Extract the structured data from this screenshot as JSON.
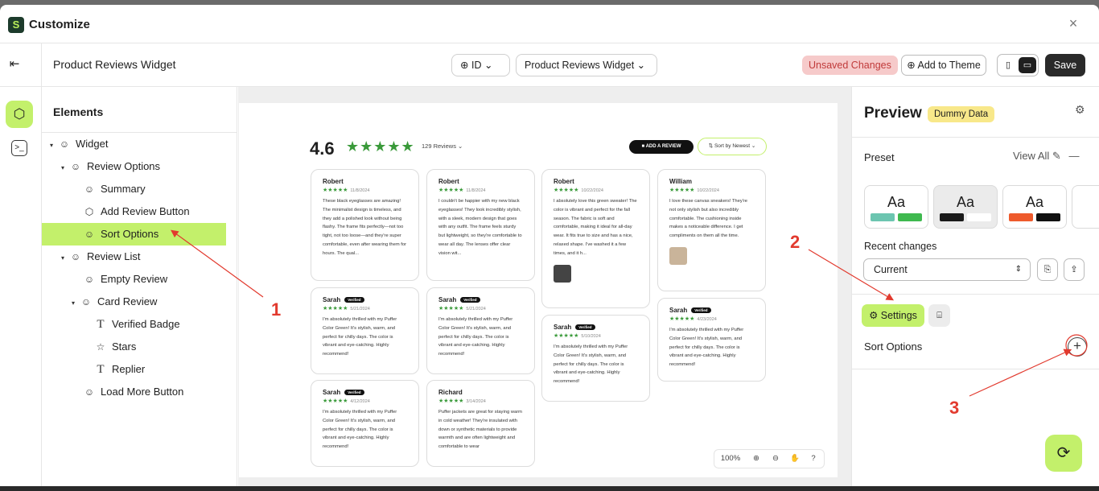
{
  "window": {
    "title": "Customize",
    "logo_letter": "S",
    "close": "×"
  },
  "toolbar": {
    "widget_title": "Product Reviews Widget",
    "lang": "ID",
    "widget_select": "Product Reviews Widget",
    "unsaved": "Unsaved Changes",
    "add_theme": "Add to Theme",
    "save": "Save"
  },
  "elements": {
    "header": "Elements",
    "tree": [
      {
        "label": "Widget"
      },
      {
        "label": "Review Options"
      },
      {
        "label": "Summary"
      },
      {
        "label": "Add Review Button"
      },
      {
        "label": "Sort Options"
      },
      {
        "label": "Review List"
      },
      {
        "label": "Empty Review"
      },
      {
        "label": "Card Review"
      },
      {
        "label": "Verified Badge"
      },
      {
        "label": "Stars"
      },
      {
        "label": "Replier"
      },
      {
        "label": "Load More Button"
      }
    ]
  },
  "preview_widget": {
    "rating": "4.6",
    "stars": "★★★★★",
    "review_count": "129 Reviews ⌄",
    "add_review": "ADD A REVIEW",
    "sort": "⇅ Sort by Newest ⌄",
    "verified": "Verified",
    "cards": [
      {
        "name": "Robert",
        "date": "11/8/2024",
        "text": "These black eyeglasses are amazing! The minimalist design is timeless, and they add a polished look without being flashy. The frame fits perfectly—not too tight, not too loose—and they're super comfortable, even after wearing them for hours. The qual..."
      },
      {
        "name": "Robert",
        "date": "11/8/2024",
        "text": "I couldn't be happier with my new black eyeglasses! They look incredibly stylish, with a sleek, modern design that goes with any outfit. The frame feels sturdy but lightweight, so they're comfortable to wear all day. The lenses offer clear vision wit..."
      },
      {
        "name": "Robert",
        "date": "10/22/2024",
        "text": "I absolutely love this green sweater! The color is vibrant and perfect for the fall season. The fabric is soft and comfortable, making it ideal for all-day wear. It fits true to size and has a nice, relaxed shape. I've washed it a few times, and it h..."
      },
      {
        "name": "William",
        "date": "10/22/2024",
        "text": "I love these canvas sneakers! They're not only stylish but also incredibly comfortable. The cushioning inside makes a noticeable difference. I get compliments on them all the time."
      },
      {
        "name": "Sarah",
        "date": "5/21/2024",
        "text": "I'm absolutely thrilled with my Puffer Color Green! It's stylish, warm, and perfect for chilly days. The color is vibrant and eye-catching. Highly recommend!"
      },
      {
        "name": "Sarah",
        "date": "5/21/2024",
        "text": "I'm absolutely thrilled with my Puffer Color Green! It's stylish, warm, and perfect for chilly days. The color is vibrant and eye-catching. Highly recommend!"
      },
      {
        "name": "Sarah",
        "date": "5/10/2024",
        "text": "I'm absolutely thrilled with my Puffer Color Green! It's stylish, warm, and perfect for chilly days. The color is vibrant and eye-catching. Highly recommend!"
      },
      {
        "name": "Sarah",
        "date": "4/23/2024",
        "text": "I'm absolutely thrilled with my Puffer Color Green! It's stylish, warm, and perfect for chilly days. The color is vibrant and eye-catching. Highly recommend!"
      },
      {
        "name": "Sarah",
        "date": "4/12/2024",
        "text": "I'm absolutely thrilled with my Puffer Color Green! It's stylish, warm, and perfect for chilly days. The color is vibrant and eye-catching. Highly recommend!"
      },
      {
        "name": "Richard",
        "date": "3/14/2024",
        "text": "Puffer jackets are great for staying warm in cold weather! They're insulated with down or synthetic materials to provide warmth and are often lightweight and comfortable to wear"
      }
    ],
    "zoom": "100%"
  },
  "preview_panel": {
    "title": "Preview",
    "badge": "Dummy Data",
    "preset_label": "Preset",
    "view_all": "View All",
    "preset_aa": "Aa",
    "recent_label": "Recent changes",
    "current": "Current",
    "settings_tab": "Settings",
    "sort_options": "Sort Options",
    "add": "+"
  },
  "annotations": {
    "one": "1",
    "two": "2",
    "three": "3"
  },
  "colors": {
    "accent": "#c3f06b",
    "star": "#3a9a3a",
    "annotation": "#e23a2e",
    "dummy_badge": "#f8e88a"
  }
}
